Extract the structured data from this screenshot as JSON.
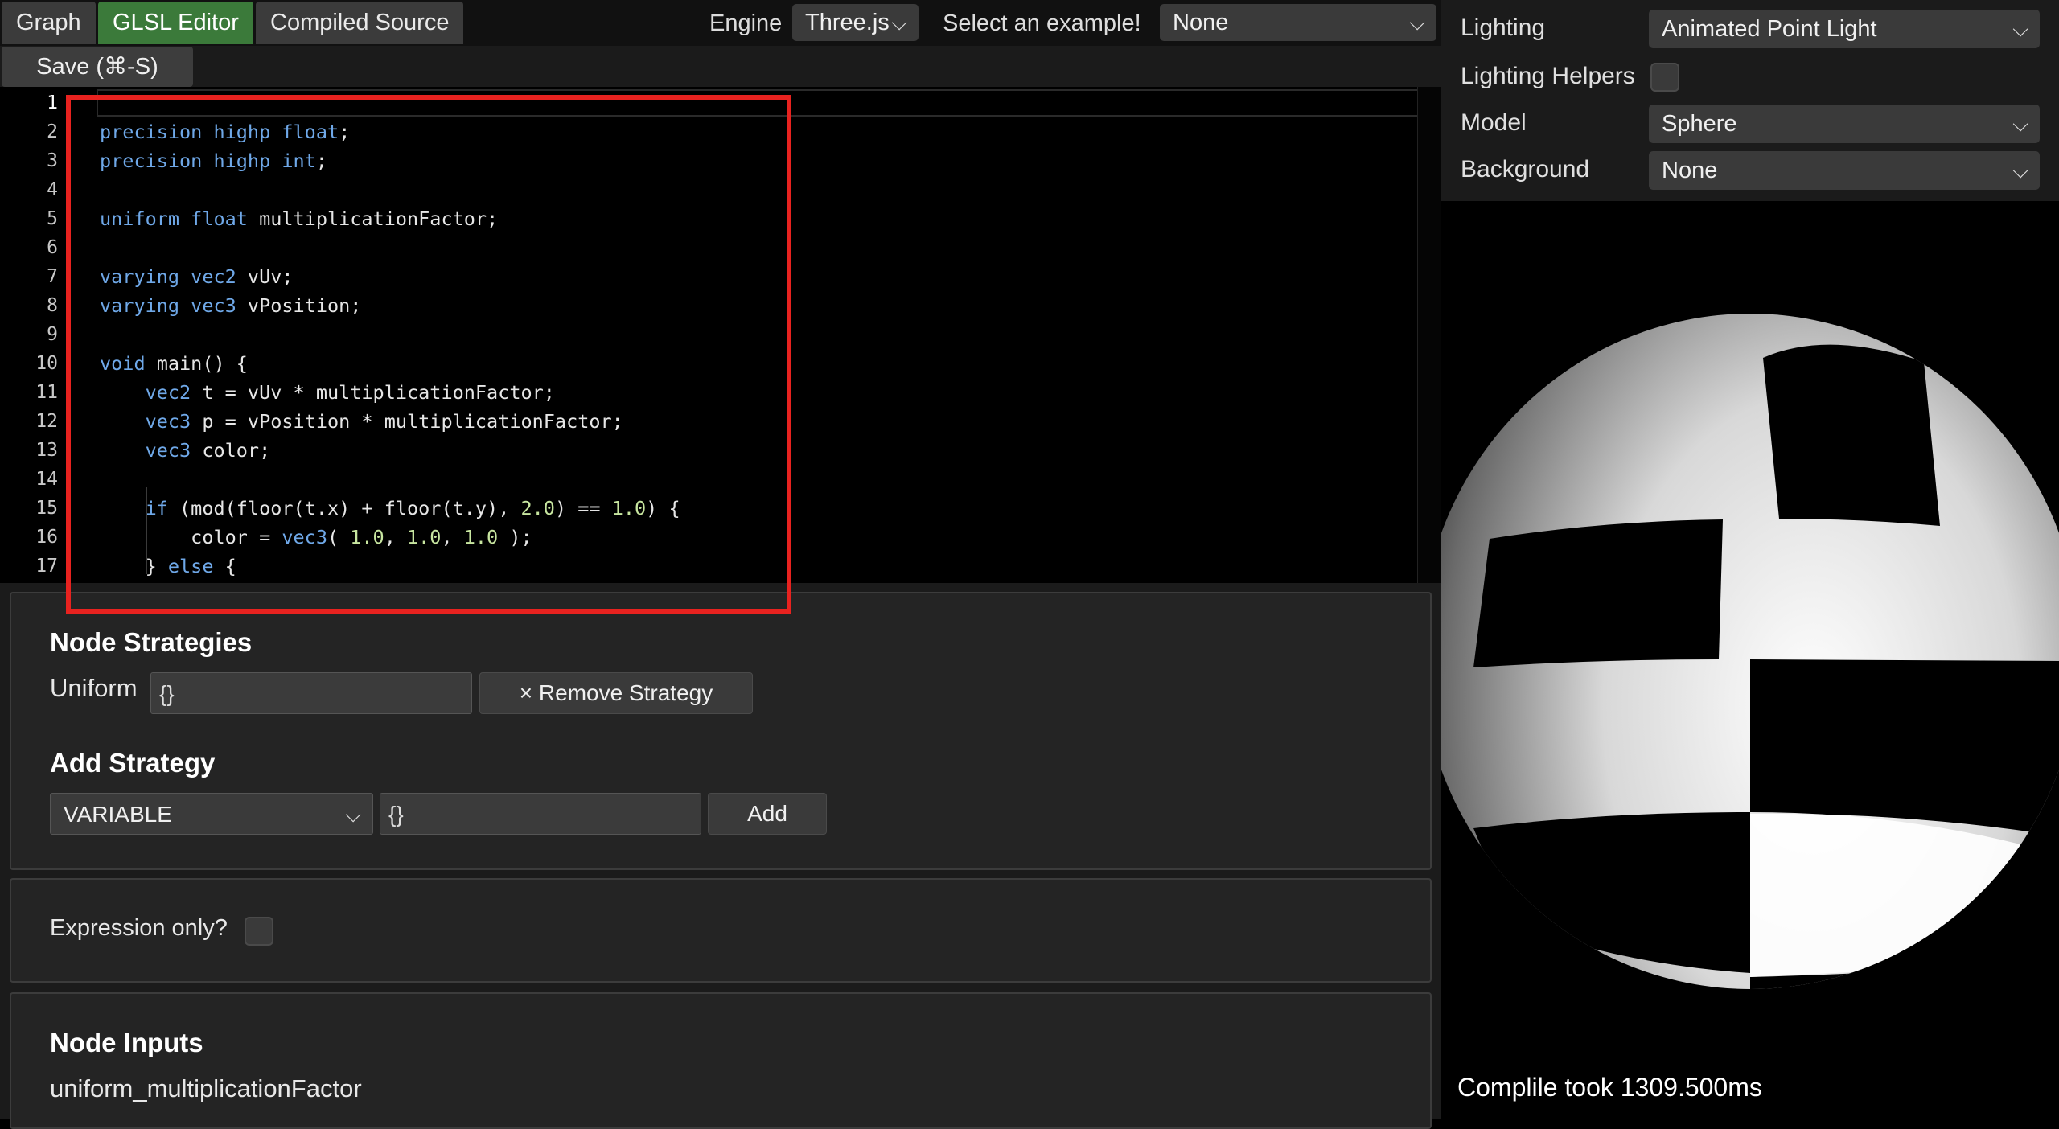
{
  "tabs": [
    {
      "label": "Graph",
      "active": false
    },
    {
      "label": "GLSL Editor",
      "active": true
    },
    {
      "label": "Compiled Source",
      "active": false
    }
  ],
  "toolbar": {
    "engine_label": "Engine",
    "engine_value": "Three.js",
    "example_label": "Select an example!",
    "example_value": "None"
  },
  "save_button": "Save (⌘-S)",
  "editor": {
    "current_line": 1,
    "lines": [
      [],
      [
        [
          "kw",
          "precision highp float"
        ],
        [
          "t",
          ";"
        ]
      ],
      [
        [
          "kw",
          "precision highp int"
        ],
        [
          "t",
          ";"
        ]
      ],
      [],
      [
        [
          "kw",
          "uniform float"
        ],
        [
          "t",
          " multiplicationFactor;"
        ]
      ],
      [],
      [
        [
          "kw",
          "varying vec2"
        ],
        [
          "t",
          " vUv;"
        ]
      ],
      [
        [
          "kw",
          "varying vec3"
        ],
        [
          "t",
          " vPosition;"
        ]
      ],
      [],
      [
        [
          "kw",
          "void"
        ],
        [
          "t",
          " main() {"
        ]
      ],
      [
        [
          "t",
          "    "
        ],
        [
          "kw",
          "vec2"
        ],
        [
          "t",
          " t = vUv * multiplicationFactor;"
        ]
      ],
      [
        [
          "t",
          "    "
        ],
        [
          "kw",
          "vec3"
        ],
        [
          "t",
          " p = vPosition * multiplicationFactor;"
        ]
      ],
      [
        [
          "t",
          "    "
        ],
        [
          "kw",
          "vec3"
        ],
        [
          "t",
          " color;"
        ]
      ],
      [],
      [
        [
          "t",
          "    "
        ],
        [
          "kw",
          "if"
        ],
        [
          "t",
          " (mod(floor(t.x) + floor(t.y), "
        ],
        [
          "num",
          "2.0"
        ],
        [
          "t",
          ") == "
        ],
        [
          "num",
          "1.0"
        ],
        [
          "t",
          ") {"
        ]
      ],
      [
        [
          "t",
          "        color = "
        ],
        [
          "kw",
          "vec3"
        ],
        [
          "t",
          "( "
        ],
        [
          "num",
          "1.0"
        ],
        [
          "t",
          ", "
        ],
        [
          "num",
          "1.0"
        ],
        [
          "t",
          ", "
        ],
        [
          "num",
          "1.0"
        ],
        [
          "t",
          " );"
        ]
      ],
      [
        [
          "t",
          "    } "
        ],
        [
          "kw",
          "else"
        ],
        [
          "t",
          " {"
        ]
      ]
    ]
  },
  "node_strategies": {
    "heading": "Node Strategies",
    "strategy_name": "Uniform",
    "strategy_value": "{}",
    "remove_button": "× Remove Strategy"
  },
  "add_strategy": {
    "heading": "Add Strategy",
    "type_value": "VARIABLE",
    "config_value": "{}",
    "add_button": "Add"
  },
  "expression_only": {
    "label": "Expression only?",
    "checked": false
  },
  "node_inputs": {
    "heading": "Node Inputs",
    "items": [
      "uniform_multiplicationFactor"
    ]
  },
  "preview_settings": {
    "lighting_label": "Lighting",
    "lighting_value": "Animated Point Light",
    "helpers_label": "Lighting Helpers",
    "helpers_checked": false,
    "model_label": "Model",
    "model_value": "Sphere",
    "background_label": "Background",
    "background_value": "None"
  },
  "compile_status": "Complile took 1309.500ms",
  "colors": {
    "active_tab": "#3b7a3a",
    "keyword": "#6fa8e8",
    "number": "#c8e6a0",
    "highlight_box": "#e8221f"
  }
}
